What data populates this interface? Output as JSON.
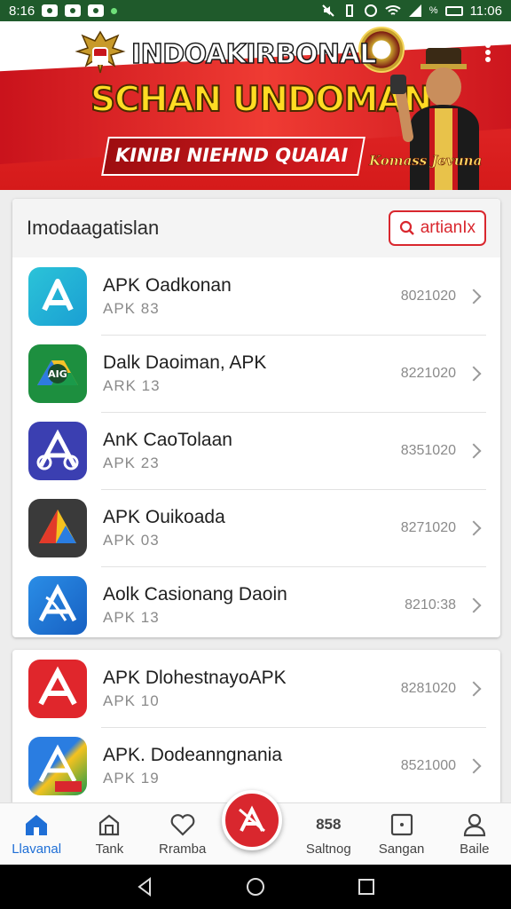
{
  "status_bar": {
    "time_left": "8:16",
    "battery_text": "%",
    "time_right": "11:06"
  },
  "banner": {
    "title_line1": "INDOAKIRBONAL",
    "title_line2": "SCHAN UNDOMAN",
    "subtitle": "KINIBI NIEHND QUAIAI",
    "corner_label": "Komass Jevuna",
    "colors": {
      "red": "#d51a1a",
      "yellow": "#ffdc23"
    }
  },
  "list_card": {
    "title": "Imodaagatislan",
    "search_label": "artianIx"
  },
  "apps": [
    {
      "name": "APK Oadkonan",
      "sub": "APK 83",
      "code": "8021020",
      "icon": "apk-app-icon-teal"
    },
    {
      "name": "Dalk Daoiman, APK",
      "sub": "ARK 13",
      "code": "8221020",
      "icon": "apk-app-icon-drive"
    },
    {
      "name": "AnK CaoTolaan",
      "sub": "APK 23",
      "code": "8351020",
      "icon": "apk-app-icon-indigo"
    },
    {
      "name": "APK Ouikoada",
      "sub": "APK 03",
      "code": "8271020",
      "icon": "apk-app-icon-dark"
    },
    {
      "name": "Aolk Casionang Daoin",
      "sub": "APK 13",
      "code": "8210:38",
      "icon": "apk-app-icon-blue"
    },
    {
      "name": "APK DlohestnayoAPK",
      "sub": "APK 10",
      "code": "8281020",
      "icon": "apk-app-icon-red"
    },
    {
      "name": "APK. Dodeanngnania",
      "sub": "APK 19",
      "code": "8521000",
      "icon": "apk-app-icon-gradient"
    }
  ],
  "bottom_nav": [
    {
      "label": "Llavanal",
      "icon": "home-icon",
      "active": true
    },
    {
      "label": "Tank",
      "icon": "store-icon",
      "active": false
    },
    {
      "label": "Rramba",
      "icon": "heart-icon",
      "active": false
    },
    {
      "label": "Saltnog",
      "icon": "grid-text-icon",
      "active": false
    },
    {
      "label": "Sangan",
      "icon": "square-message-icon",
      "active": false
    },
    {
      "label": "Baile",
      "icon": "person-icon",
      "active": false
    }
  ],
  "bottom_nav_extra_label": "858"
}
